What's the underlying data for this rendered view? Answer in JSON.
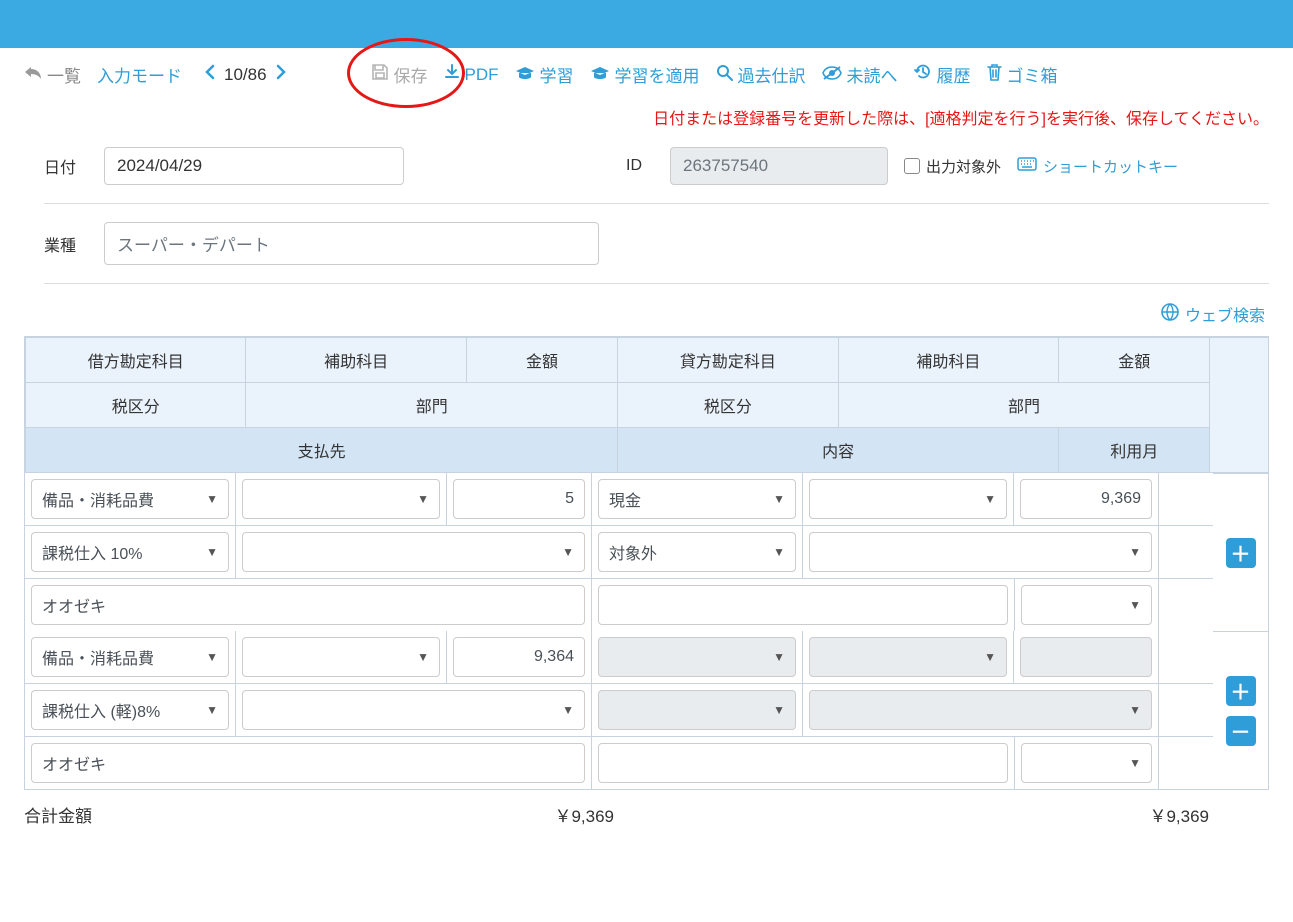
{
  "toolbar": {
    "back": "一覧",
    "input_mode": "入力モード",
    "counter": "10/86",
    "save": "保存",
    "pdf": "PDF",
    "learn": "学習",
    "apply_learn": "学習を適用",
    "past_journal": "過去仕訳",
    "to_unread": "未読へ",
    "history": "履歴",
    "trash": "ゴミ箱"
  },
  "notice": "日付または登録番号を更新した際は、[適格判定を行う]を実行後、保存してください。",
  "form": {
    "date_label": "日付",
    "date_value": "2024/04/29",
    "id_label": "ID",
    "id_value": "263757540",
    "exclude_label": "出力対象外",
    "shortcut": "ショートカットキー",
    "industry_label": "業種",
    "industry_value": "スーパー・デパート",
    "websearch": "ウェブ検索"
  },
  "headers": {
    "debit_acct": "借方勘定科目",
    "sub_acct": "補助科目",
    "amount": "金額",
    "credit_acct": "貸方勘定科目",
    "tax": "税区分",
    "dept": "部門",
    "payee": "支払先",
    "content": "内容",
    "month": "利用月"
  },
  "rows": [
    {
      "debit_acct": "備品・消耗品費",
      "debit_sub": "",
      "debit_amount": "5",
      "credit_acct": "現金",
      "credit_sub": "",
      "credit_amount": "9,369",
      "debit_tax": "課税仕入 10%",
      "debit_dept": "",
      "credit_tax": "対象外",
      "credit_dept": "",
      "payee": "オオゼキ",
      "content": "",
      "month": "",
      "credit_disabled": false
    },
    {
      "debit_acct": "備品・消耗品費",
      "debit_sub": "",
      "debit_amount": "9,364",
      "credit_acct": "",
      "credit_sub": "",
      "credit_amount": "",
      "debit_tax": "課税仕入 (軽)8%",
      "debit_dept": "",
      "credit_tax": "",
      "credit_dept": "",
      "payee": "オオゼキ",
      "content": "",
      "month": "",
      "credit_disabled": true
    }
  ],
  "totals": {
    "label": "合計金額",
    "debit": "￥9,369",
    "credit": "￥9,369"
  }
}
